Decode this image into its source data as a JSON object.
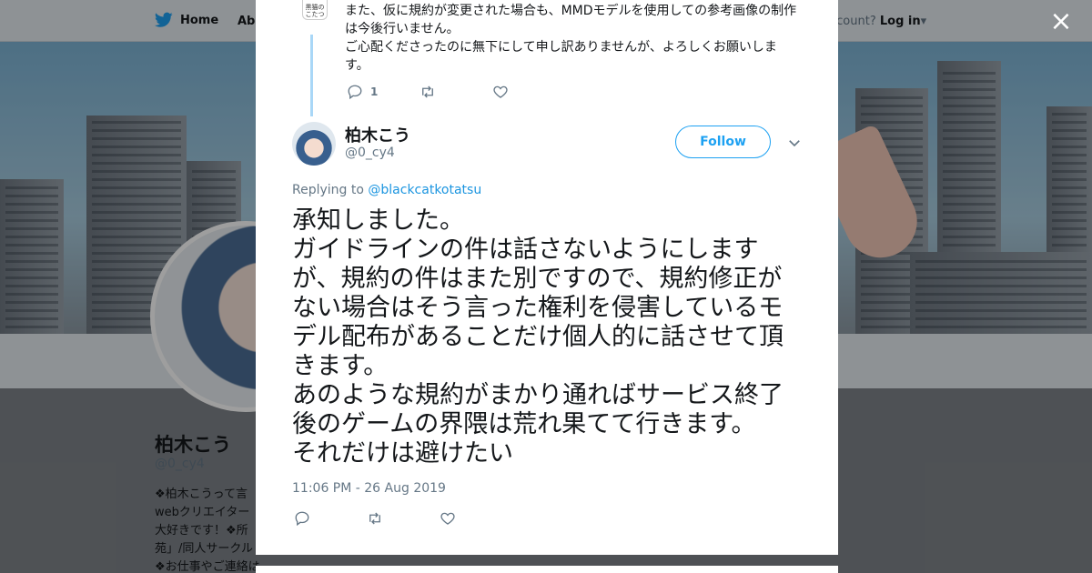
{
  "nav": {
    "home_label": "Home",
    "about_label": "Abo",
    "account_prompt": "ccount?",
    "login_label": "Log in"
  },
  "profile": {
    "name": "柏木こう",
    "handle": "@0_cy4",
    "bio": "❖柏木こうって言\nwebクリエイター\n大好きです！❖所\n苑」/同人サークル\n❖お仕事やご連絡はDMからどうぞ！"
  },
  "close_label": "×",
  "previous_tweet": {
    "avatar_text": "黒猫の\nこたつ",
    "text": "また、仮に規約が変更された場合も、MMDモデルを使用しての参考画像の制作は今後行いません。\nご心配くださったのに無下にして申し訳ありませんが、よろしくお願いします。",
    "reply_count": "1",
    "retweet_count": "",
    "like_count": ""
  },
  "tweet": {
    "author_name": "柏木こう",
    "author_handle": "@0_cy4",
    "follow_label": "Follow",
    "replying_prefix": "Replying to",
    "replying_to": "@blackcatkotatsu",
    "text": "承知しました。\nガイドラインの件は話さないようにしますが、規約の件はまた別ですので、規約修正がない場合はそう言った権利を侵害しているモデル配布があることだけ個人的に話させて頂きます。\nあのような規約がまかり通ればサービス終了後のゲームの界隈は荒れ果てて行きます。\nそれだけは避けたい",
    "timestamp": "11:06 PM - 26 Aug 2019",
    "reply_count": "",
    "retweet_count": "",
    "like_count": ""
  },
  "colors": {
    "accent": "#1da1f2",
    "link": "#1b95e0",
    "secondary_text": "#657786",
    "primary_text": "#14171a",
    "thread_line": "#a9d7f7"
  }
}
